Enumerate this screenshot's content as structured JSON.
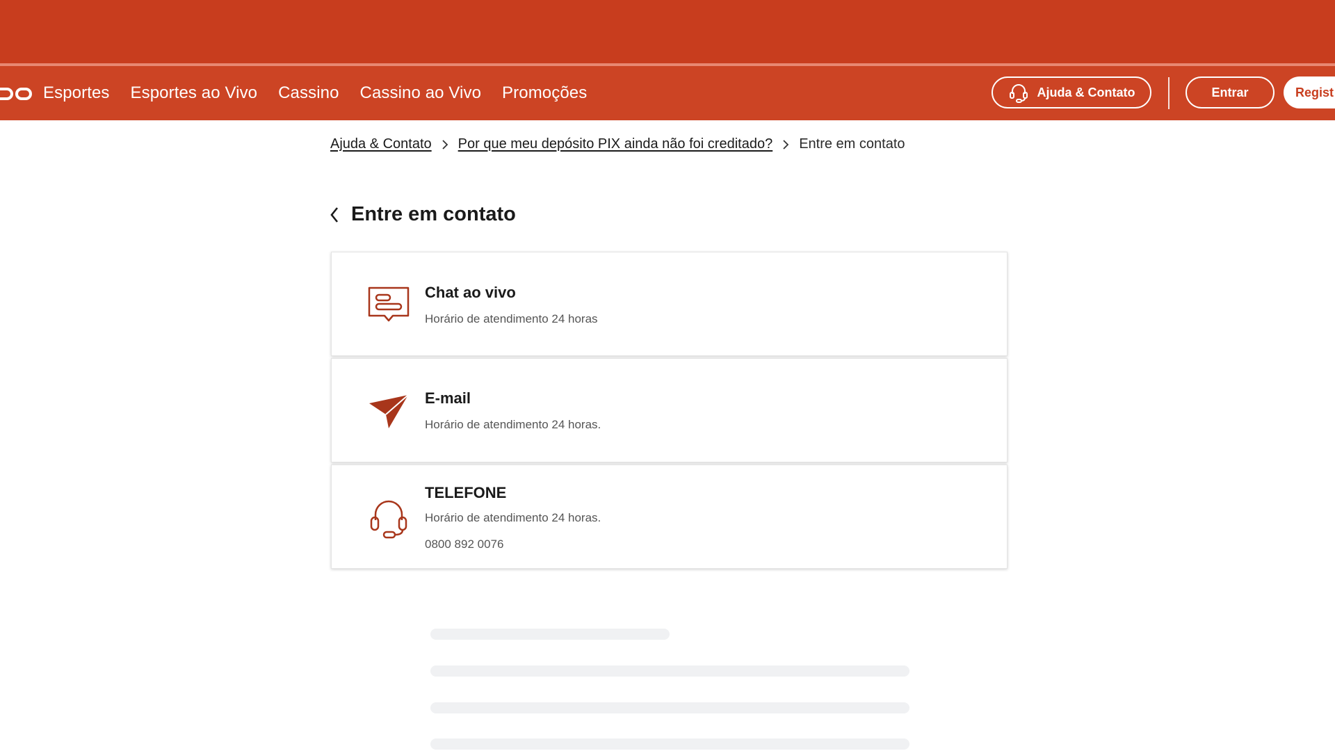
{
  "colors": {
    "brand": "#c83d1e",
    "nav": "#cc4424",
    "icon": "#a8361b",
    "skeleton": "#f0f1f3"
  },
  "header": {
    "logo_icon": "logo-fragment",
    "nav": [
      "Esportes",
      "Esportes ao Vivo",
      "Cassino",
      "Cassino ao Vivo",
      "Promoções"
    ],
    "help_label": "Ajuda & Contato",
    "help_icon": "headset-icon",
    "login_label": "Entrar",
    "register_label": "Regist"
  },
  "breadcrumb": {
    "items": [
      "Ajuda & Contato",
      "Por que meu depósito PIX ainda não foi creditado?"
    ],
    "current": "Entre em contato"
  },
  "page": {
    "title": "Entre em contato",
    "back_icon": "chevron-left-icon"
  },
  "contacts": [
    {
      "icon": "chat-icon",
      "title": "Chat ao vivo",
      "subtitle": "Horário de atendimento 24 horas"
    },
    {
      "icon": "paper-plane-icon",
      "title": "E-mail",
      "subtitle": "Horário de atendimento 24 horas."
    },
    {
      "icon": "headset-icon",
      "title": "TELEFONE",
      "subtitle": "Horário de atendimento 24 horas.",
      "phone": "0800 892 0076"
    }
  ]
}
